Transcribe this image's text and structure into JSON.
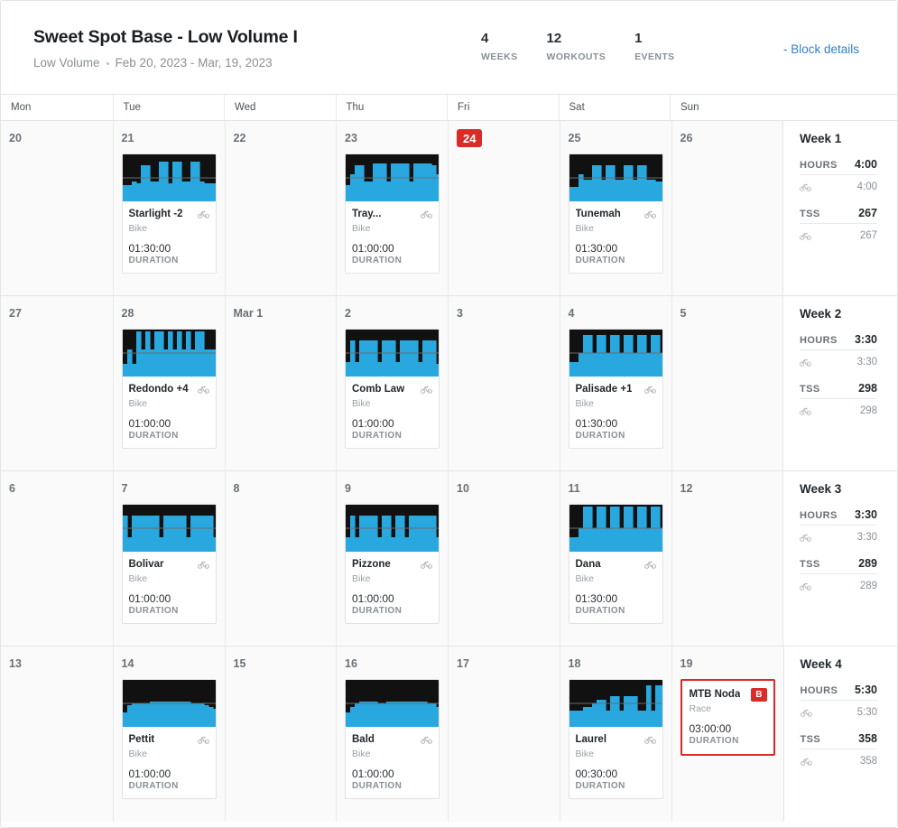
{
  "header": {
    "title": "Sweet Spot Base - Low Volume I",
    "volume": "Low Volume",
    "date_range": "Feb 20, 2023 - Mar, 19, 2023",
    "stats": [
      {
        "value": "4",
        "label": "WEEKS"
      },
      {
        "value": "12",
        "label": "WORKOUTS"
      },
      {
        "value": "1",
        "label": "EVENTS"
      }
    ],
    "block_details_link": "- Block details",
    "accent_blue": "#2f7fd1",
    "accent_red": "#d92b27",
    "chart_blue": "#29a8e0"
  },
  "calendar": {
    "day_headers": [
      "Mon",
      "Tue",
      "Wed",
      "Thu",
      "Fri",
      "Sat",
      "Sun"
    ],
    "duration_label": "DURATION",
    "weeks": [
      {
        "summary": {
          "title": "Week 1",
          "hours_label": "HOURS",
          "hours_value": "4:00",
          "hours_bike": "4:00",
          "tss_label": "TSS",
          "tss_value": "267",
          "tss_bike": "267"
        },
        "days": [
          {
            "num": "20",
            "today": false,
            "workout": null
          },
          {
            "num": "21",
            "today": false,
            "workout": {
              "name": "Starlight -2",
              "type": "Bike",
              "duration": "01:30:00",
              "event": false,
              "profile": [
                18,
                18,
                22,
                20,
                40,
                40,
                22,
                22,
                44,
                44,
                20,
                44,
                44,
                22,
                22,
                44,
                44,
                22,
                20,
                20,
                20
              ]
            }
          },
          {
            "num": "22",
            "today": false,
            "workout": null
          },
          {
            "num": "23",
            "today": false,
            "workout": {
              "name": "Tray...",
              "type": "Bike",
              "duration": "01:00:00",
              "event": false,
              "profile": [
                18,
                30,
                40,
                40,
                22,
                22,
                42,
                42,
                42,
                22,
                42,
                42,
                42,
                42,
                22,
                42,
                42,
                42,
                42,
                40,
                30
              ]
            }
          },
          {
            "num": "24",
            "today": true,
            "workout": null
          },
          {
            "num": "25",
            "today": false,
            "workout": {
              "name": "Tunemah",
              "type": "Bike",
              "duration": "01:30:00",
              "event": false,
              "profile": [
                16,
                16,
                30,
                24,
                24,
                40,
                40,
                24,
                40,
                40,
                24,
                24,
                40,
                40,
                24,
                40,
                40,
                24,
                24,
                22,
                22
              ]
            }
          },
          {
            "num": "26",
            "today": false,
            "workout": null
          }
        ]
      },
      {
        "summary": {
          "title": "Week 2",
          "hours_label": "HOURS",
          "hours_value": "3:30",
          "hours_bike": "3:30",
          "tss_label": "TSS",
          "tss_value": "298",
          "tss_bike": "298"
        },
        "days": [
          {
            "num": "27",
            "today": false,
            "workout": null
          },
          {
            "num": "28",
            "today": false,
            "workout": {
              "name": "Redondo +4",
              "type": "Bike",
              "duration": "01:00:00",
              "event": false,
              "profile": [
                14,
                30,
                14,
                62,
                30,
                62,
                30,
                62,
                62,
                30,
                62,
                30,
                62,
                30,
                62,
                30,
                62,
                62,
                30,
                30,
                30
              ]
            }
          },
          {
            "num": "Mar 1",
            "today": false,
            "workout": null
          },
          {
            "num": "2",
            "today": false,
            "workout": {
              "name": "Comb Law",
              "type": "Bike",
              "duration": "01:00:00",
              "event": false,
              "profile": [
                16,
                40,
                16,
                40,
                40,
                40,
                40,
                16,
                40,
                40,
                40,
                16,
                40,
                40,
                40,
                40,
                16,
                40,
                40,
                40,
                14
              ]
            }
          },
          {
            "num": "3",
            "today": false,
            "workout": null
          },
          {
            "num": "4",
            "today": false,
            "workout": {
              "name": "Palisade +1",
              "type": "Bike",
              "duration": "01:30:00",
              "event": false,
              "profile": [
                16,
                16,
                26,
                46,
                46,
                26,
                46,
                46,
                26,
                46,
                46,
                26,
                46,
                46,
                26,
                46,
                46,
                26,
                46,
                46,
                26
              ]
            }
          },
          {
            "num": "5",
            "today": false,
            "workout": null
          }
        ]
      },
      {
        "summary": {
          "title": "Week 3",
          "hours_label": "HOURS",
          "hours_value": "3:30",
          "hours_bike": "3:30",
          "tss_label": "TSS",
          "tss_value": "289",
          "tss_bike": "289"
        },
        "days": [
          {
            "num": "6",
            "today": false,
            "workout": null
          },
          {
            "num": "7",
            "today": false,
            "workout": {
              "name": "Bolivar",
              "type": "Bike",
              "duration": "01:00:00",
              "event": false,
              "profile": [
                40,
                16,
                40,
                40,
                40,
                40,
                40,
                40,
                16,
                40,
                40,
                40,
                40,
                40,
                16,
                40,
                40,
                40,
                40,
                40,
                16
              ]
            }
          },
          {
            "num": "8",
            "today": false,
            "workout": null
          },
          {
            "num": "9",
            "today": false,
            "workout": {
              "name": "Pizzone",
              "type": "Bike",
              "duration": "01:00:00",
              "event": false,
              "profile": [
                16,
                40,
                16,
                40,
                40,
                40,
                40,
                16,
                40,
                40,
                16,
                40,
                40,
                16,
                40,
                40,
                40,
                40,
                40,
                40,
                16
              ]
            }
          },
          {
            "num": "10",
            "today": false,
            "workout": null
          },
          {
            "num": "11",
            "today": false,
            "workout": {
              "name": "Dana",
              "type": "Bike",
              "duration": "01:30:00",
              "event": false,
              "profile": [
                16,
                16,
                26,
                50,
                50,
                26,
                50,
                50,
                26,
                50,
                50,
                26,
                50,
                50,
                26,
                50,
                50,
                26,
                50,
                50,
                26
              ]
            }
          },
          {
            "num": "12",
            "today": false,
            "workout": null
          }
        ]
      },
      {
        "summary": {
          "title": "Week 4",
          "hours_label": "HOURS",
          "hours_value": "5:30",
          "hours_bike": "5:30",
          "tss_label": "TSS",
          "tss_value": "358",
          "tss_bike": "358"
        },
        "days": [
          {
            "num": "13",
            "today": false,
            "workout": null
          },
          {
            "num": "14",
            "today": false,
            "workout": {
              "name": "Pettit",
              "type": "Bike",
              "duration": "01:00:00",
              "event": false,
              "profile": [
                16,
                24,
                26,
                26,
                26,
                26,
                28,
                28,
                28,
                28,
                28,
                28,
                28,
                28,
                28,
                26,
                26,
                26,
                24,
                22,
                20
              ]
            }
          },
          {
            "num": "15",
            "today": false,
            "workout": null
          },
          {
            "num": "16",
            "today": false,
            "workout": {
              "name": "Bald",
              "type": "Bike",
              "duration": "01:00:00",
              "event": false,
              "profile": [
                16,
                22,
                26,
                28,
                28,
                28,
                28,
                26,
                26,
                28,
                28,
                28,
                28,
                28,
                28,
                28,
                28,
                28,
                26,
                26,
                22
              ]
            }
          },
          {
            "num": "17",
            "today": false,
            "workout": null
          },
          {
            "num": "18",
            "today": false,
            "workout": {
              "name": "Laurel",
              "type": "Bike",
              "duration": "00:30:00",
              "event": false,
              "profile": [
                18,
                18,
                18,
                22,
                22,
                26,
                30,
                30,
                18,
                34,
                34,
                18,
                34,
                34,
                34,
                18,
                18,
                46,
                18,
                46,
                46
              ]
            }
          },
          {
            "num": "19",
            "today": false,
            "workout": {
              "name": "MTB Noda",
              "type": "Race",
              "duration": "03:00:00",
              "event": true,
              "badge": "B",
              "profile": []
            }
          }
        ]
      }
    ]
  }
}
